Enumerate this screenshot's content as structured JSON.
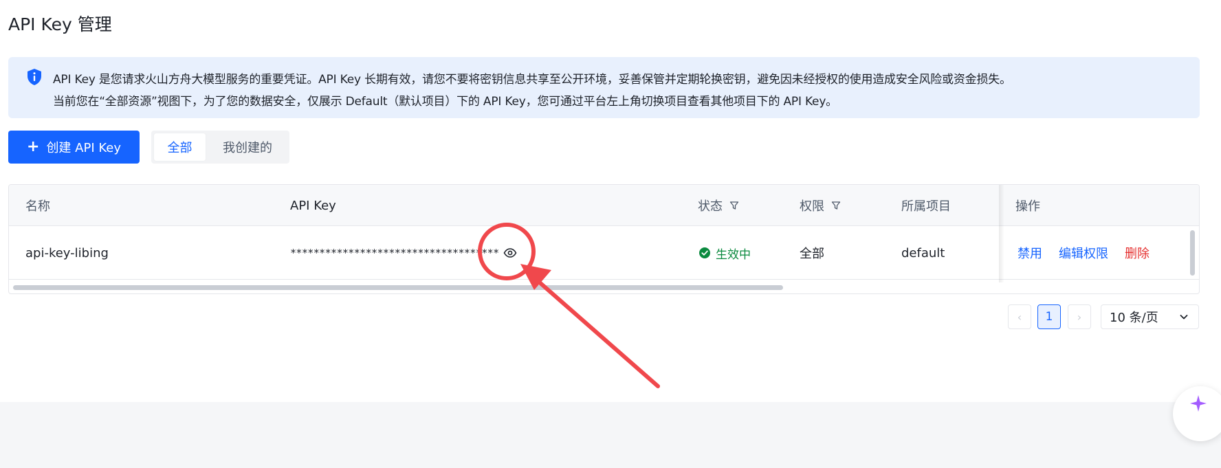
{
  "page": {
    "title": "API Key 管理"
  },
  "notice": {
    "line1": "API Key 是您请求火山方舟大模型服务的重要凭证。API Key 长期有效，请您不要将密钥信息共享至公开环境，妥善保管并定期轮换密钥，避免因未经授权的使用造成安全风险或资金损失。",
    "line2": "当前您在“全部资源”视图下，为了您的数据安全，仅展示 Default（默认项目）下的 API Key，您可通过平台左上角切换项目查看其他项目下的 API Key。",
    "icon": "shield-info-icon"
  },
  "toolbar": {
    "create_plus": "+",
    "create_label": "创建 API Key",
    "tabs": [
      {
        "label": "全部",
        "active": true
      },
      {
        "label": "我创建的",
        "active": false
      }
    ]
  },
  "table": {
    "columns": {
      "name": "名称",
      "api_key": "API Key",
      "status": "状态",
      "permission": "权限",
      "project": "所属项目",
      "actions": "操作"
    },
    "rows": [
      {
        "name": "api-key-libing",
        "api_key_masked": "************************************",
        "status": "生效中",
        "permission": "全部",
        "project": "default",
        "actions": {
          "disable": "禁用",
          "edit": "编辑权限",
          "delete": "删除"
        }
      }
    ]
  },
  "pagination": {
    "prev": "‹",
    "current": "1",
    "next": "›",
    "page_size": "10 条/页"
  },
  "colors": {
    "primary": "#1664ff",
    "success": "#0b8a3f",
    "danger": "#e5302f",
    "annotation": "#f0484c"
  }
}
